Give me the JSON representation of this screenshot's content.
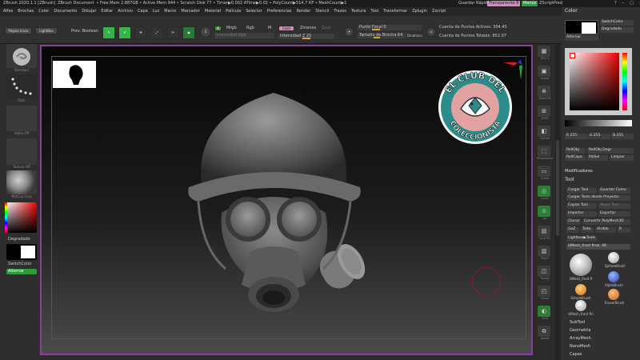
{
  "titlebar": {
    "items": [
      "ZBrush 2020.1.1 [ZBrush]",
      "ZBrush Document",
      "• Free Mem 2.887GB • Active Mem 944 • Scratch Disk 77 • Timer▶0.002 ATime▶0.02 • PolyCount▶514.7 KP • MeshCount▶1"
    ],
    "quick_save": "Guardar Rápido",
    "transparency": "Transparente 8",
    "menus_label": "Menús",
    "script": "ZScriptPred"
  },
  "menubar": [
    "Alfes",
    "Brochas",
    "Color",
    "Documento",
    "Dibujar",
    "Editar",
    "Archivo",
    "Capa",
    "Luz",
    "Macro",
    "Marcador",
    "Material",
    "Película",
    "Selector",
    "Preferencias",
    "Render",
    "Stencil",
    "Trazos",
    "Textura",
    "Tool",
    "Transformar",
    "Zplugin",
    "Zscript"
  ],
  "toolbar": {
    "page_home": "Página Inicio",
    "lightbox": "LightBox",
    "prev_boolean": "Prev. Boolean",
    "btn_edit": "Editar",
    "btn_draw": "Dibujar",
    "btn_move": "Mover",
    "btn_scale": "Escalar",
    "btn_rotate": "Rotar",
    "mrgb": "Mrgb",
    "rgb": "Rgb",
    "m": "M",
    "zadd": "Zadd",
    "zsub": "Zmenos",
    "zcut": "Zcut",
    "rgb_intensity": "Intensidad Rgb",
    "z_intensity": "Intensidad Z 25",
    "focal": "Punto Focal 0",
    "brush_size": "Tamaño de Brocha 64",
    "dynamic": "Dinámico",
    "active_points": "Cuenta de Puntos Activos: 304.45",
    "total_points": "Cuenta de Puntos Totales: 852.07"
  },
  "left": {
    "brush_label": "Standard",
    "stroke_label": "Dots",
    "alpha_label": "Alpha Off",
    "texture_label": "Texture Off",
    "material_label": "MatCap Gray",
    "gradient": "Degradado",
    "switch_color": "SwitchColor",
    "alternate": "Alternar"
  },
  "rightstrip": [
    "SPix 3",
    "Actual",
    "Zoom2D",
    "100%",
    "AAHalf",
    "Perspectiva",
    "Suelo",
    "Local",
    "Loc",
    "Line Fill",
    "PolyF",
    "Transp",
    "Ghost",
    "Solo",
    "Xpose"
  ],
  "color": {
    "title": "Color",
    "switch_color": "SwitchColor",
    "gradient": "Degradado",
    "alternate": "Alternar",
    "r": "R 255",
    "g": "G 255",
    "b": "B 255",
    "fill_object": "RellObj",
    "fill_object_degr": "RellObj Degr",
    "fill_layer": "RellCapa",
    "pick_color": "PalSel",
    "clear": "Limpiar"
  },
  "modifiers": "Modificadores",
  "tool": {
    "title": "Tool",
    "load_tool": "Cargar Tool",
    "save_as": "Guardar Como",
    "load_from_project": "Cargar Tools desde Proyecto",
    "copy_tool": "Copiar Tool",
    "paste_tool": "Pegar Tool",
    "import": "Importar",
    "export": "Exportar",
    "clone": "Clonar",
    "make_polymesh": "Convertir PolyMesh3D",
    "goz": "GoZ",
    "all": "Todo",
    "visible": "Visible",
    "r_btn": "R",
    "lightbox_tools": "Lightbox▶Tools",
    "current_tool": "UMesh_front final. 48",
    "brushes": [
      "UMesh_front fi",
      "SphereBrush",
      "AlphaBrush",
      "SimpleBrush",
      "EraserBrush",
      "UMesh_front fin"
    ],
    "sections": [
      "SubTool",
      "Geometría",
      "ArrayMesh",
      "NanoMesh",
      "Capas"
    ]
  },
  "viewport": {
    "logo_text_top": "EL CLUB DEL",
    "logo_text_bottom": "COLECCIONISTA"
  },
  "colors": {
    "accent_green": "#34b548",
    "viewport_border": "#8c3ea0",
    "toggle_pink": "#d48ac0",
    "logo_teal": "#2b8d8a",
    "logo_pink": "#e3a2a2",
    "brush_ring_red": "#8a1e1e"
  }
}
